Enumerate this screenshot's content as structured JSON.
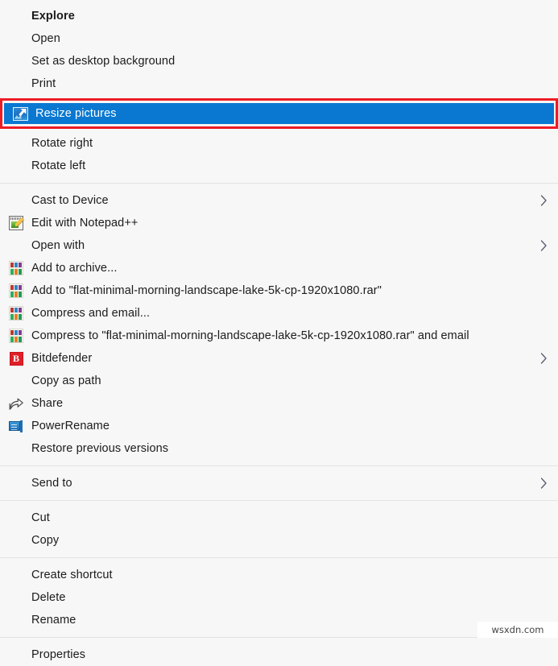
{
  "context_menu": {
    "background_color": "#f7f7f7",
    "highlight_color": "#0a78d1",
    "highlight_border_color": "#ee1c25",
    "separator_color": "#e3e3e3",
    "groups": [
      {
        "items": [
          {
            "label": "Explore",
            "icon": "none",
            "bold": true,
            "submenu": false,
            "selected": false
          },
          {
            "label": "Open",
            "icon": "none",
            "bold": false,
            "submenu": false,
            "selected": false
          },
          {
            "label": "Set as desktop background",
            "icon": "none",
            "bold": false,
            "submenu": false,
            "selected": false
          },
          {
            "label": "Print",
            "icon": "none",
            "bold": false,
            "submenu": false,
            "selected": false
          },
          {
            "label": "Resize pictures",
            "icon": "resize-pictures-icon",
            "bold": false,
            "submenu": false,
            "selected": true
          },
          {
            "label": "Rotate right",
            "icon": "none",
            "bold": false,
            "submenu": false,
            "selected": false
          },
          {
            "label": "Rotate left",
            "icon": "none",
            "bold": false,
            "submenu": false,
            "selected": false
          }
        ]
      },
      {
        "items": [
          {
            "label": "Cast to Device",
            "icon": "none",
            "bold": false,
            "submenu": true,
            "selected": false
          },
          {
            "label": "Edit with Notepad++",
            "icon": "notepad-plus-plus-icon",
            "bold": false,
            "submenu": false,
            "selected": false
          },
          {
            "label": "Open with",
            "icon": "none",
            "bold": false,
            "submenu": true,
            "selected": false
          },
          {
            "label": "Add to archive...",
            "icon": "winrar-icon",
            "bold": false,
            "submenu": false,
            "selected": false
          },
          {
            "label": "Add to \"flat-minimal-morning-landscape-lake-5k-cp-1920x1080.rar\"",
            "icon": "winrar-icon",
            "bold": false,
            "submenu": false,
            "selected": false
          },
          {
            "label": "Compress and email...",
            "icon": "winrar-icon",
            "bold": false,
            "submenu": false,
            "selected": false
          },
          {
            "label": "Compress to \"flat-minimal-morning-landscape-lake-5k-cp-1920x1080.rar\" and email",
            "icon": "winrar-icon",
            "bold": false,
            "submenu": false,
            "selected": false
          },
          {
            "label": "Bitdefender",
            "icon": "bitdefender-icon",
            "bold": false,
            "submenu": true,
            "selected": false
          },
          {
            "label": "Copy as path",
            "icon": "none",
            "bold": false,
            "submenu": false,
            "selected": false
          },
          {
            "label": "Share",
            "icon": "share-icon",
            "bold": false,
            "submenu": false,
            "selected": false
          },
          {
            "label": "PowerRename",
            "icon": "power-rename-icon",
            "bold": false,
            "submenu": false,
            "selected": false
          },
          {
            "label": "Restore previous versions",
            "icon": "none",
            "bold": false,
            "submenu": false,
            "selected": false
          }
        ]
      },
      {
        "items": [
          {
            "label": "Send to",
            "icon": "none",
            "bold": false,
            "submenu": true,
            "selected": false
          }
        ]
      },
      {
        "items": [
          {
            "label": "Cut",
            "icon": "none",
            "bold": false,
            "submenu": false,
            "selected": false
          },
          {
            "label": "Copy",
            "icon": "none",
            "bold": false,
            "submenu": false,
            "selected": false
          }
        ]
      },
      {
        "items": [
          {
            "label": "Create shortcut",
            "icon": "none",
            "bold": false,
            "submenu": false,
            "selected": false
          },
          {
            "label": "Delete",
            "icon": "none",
            "bold": false,
            "submenu": false,
            "selected": false
          },
          {
            "label": "Rename",
            "icon": "none",
            "bold": false,
            "submenu": false,
            "selected": false
          }
        ]
      },
      {
        "items": [
          {
            "label": "Properties",
            "icon": "none",
            "bold": false,
            "submenu": false,
            "selected": false
          }
        ]
      }
    ]
  },
  "watermark": {
    "text": "wsxdn.com"
  }
}
